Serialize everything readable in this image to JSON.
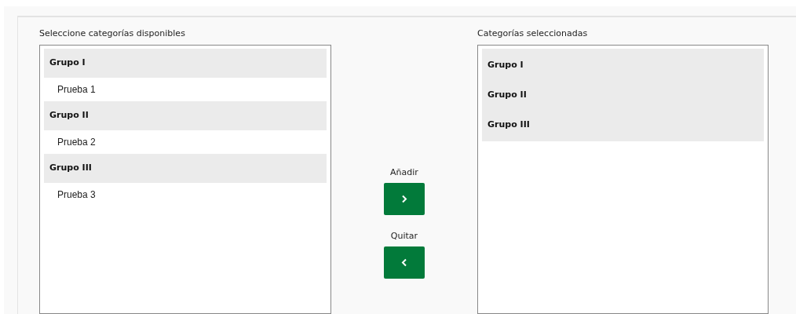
{
  "available": {
    "label": "Seleccione categorías disponibles",
    "groups": [
      {
        "name": "Grupo I",
        "options": [
          "Prueba 1"
        ]
      },
      {
        "name": "Grupo II",
        "options": [
          "Prueba 2"
        ]
      },
      {
        "name": "Grupo III",
        "options": [
          "Prueba 3"
        ]
      }
    ]
  },
  "actions": [
    {
      "kind": "add",
      "label": "Añadir"
    },
    {
      "kind": "remove",
      "label": "Quitar"
    }
  ],
  "selected": {
    "label": "Categorías seleccionadas",
    "groups": [
      {
        "name": "Grupo I"
      },
      {
        "name": "Grupo II"
      },
      {
        "name": "Grupo III"
      }
    ]
  }
}
